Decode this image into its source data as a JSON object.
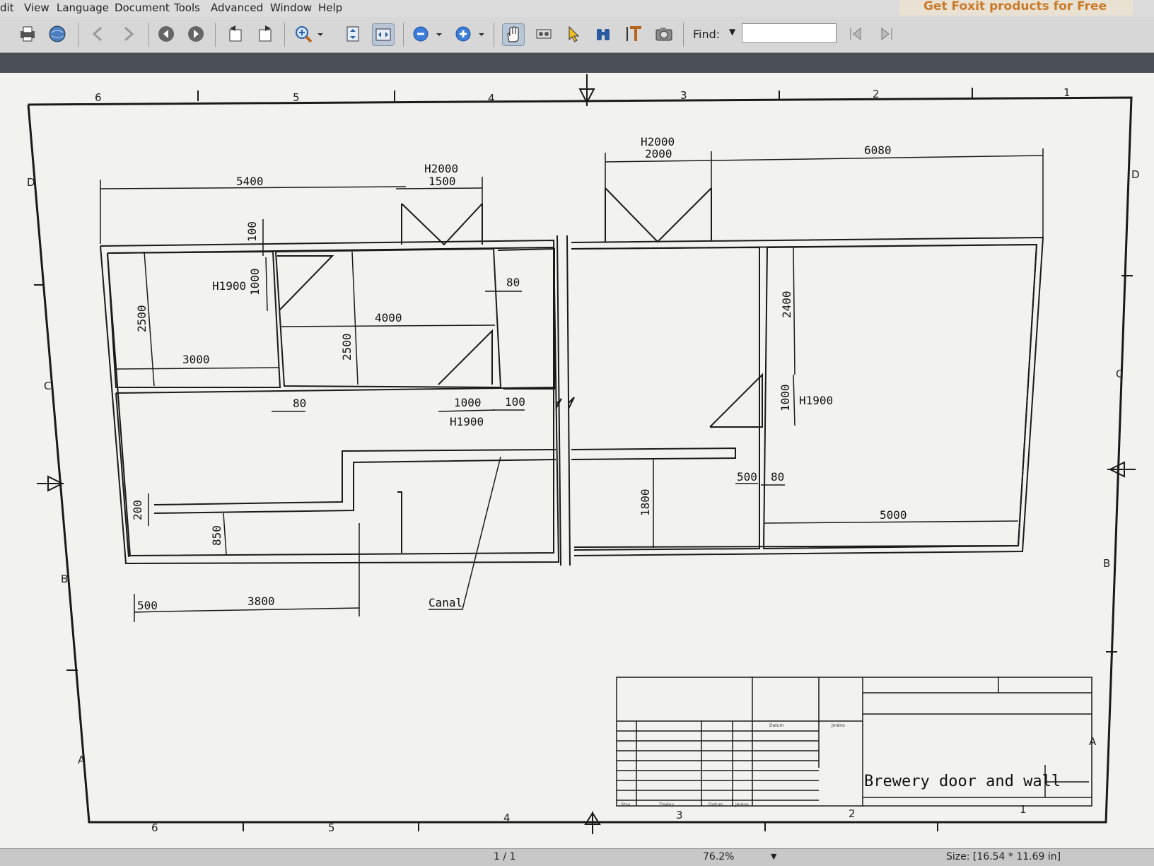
{
  "menu": {
    "edit": "dit",
    "view": "View",
    "language": "Language",
    "document": "Document",
    "tools": "Tools",
    "advanced": "Advanced",
    "window": "Window",
    "help": "Help"
  },
  "promo": "Get Foxit products for Free",
  "toolbar": {
    "find_label": "Find:",
    "find_value": ""
  },
  "drawing": {
    "grid_top": [
      "6",
      "5",
      "4",
      "3",
      "2",
      "1"
    ],
    "grid_bottom": [
      "6",
      "5",
      "4",
      "3",
      "2",
      "1"
    ],
    "grid_left": [
      "D",
      "C",
      "B",
      "A"
    ],
    "grid_right": [
      "D",
      "C",
      "B",
      "A"
    ],
    "dims": {
      "d5400": "5400",
      "door1_h": "H2000",
      "door1_w": "1500",
      "door2_h": "H2000",
      "door2_w": "2000",
      "d6080": "6080",
      "d100": "100",
      "h1900_a": "H1900",
      "d1000_a": "1000",
      "d2500_a": "2500",
      "d3000": "3000",
      "d4000": "4000",
      "d2500_b": "2500",
      "d80_a": "80",
      "d80_b": "80",
      "d1000_b": "1000",
      "h1900_b": "H1900",
      "d100_b": "100",
      "d2400": "2400",
      "d1000_c": "1000",
      "h1900_c": "H1900",
      "d500_a": "500",
      "d80_c": "80",
      "d1800": "1800",
      "d5000": "5000",
      "d200": "200",
      "d850": "850",
      "d500_b": "500",
      "d3800": "3800",
      "canal": "Canal"
    },
    "title_block": {
      "title": "Brewery door and wall",
      "datum": "Datum",
      "jmeno": "Jméno",
      "stav": "Stav",
      "zmeny": "Změny",
      "datum2": "Datum",
      "jmeno2": "Jméno"
    }
  },
  "status": {
    "pages": "1 / 1",
    "zoom": "76.2%",
    "size": "Size: [16.54 * 11.69 in]"
  }
}
